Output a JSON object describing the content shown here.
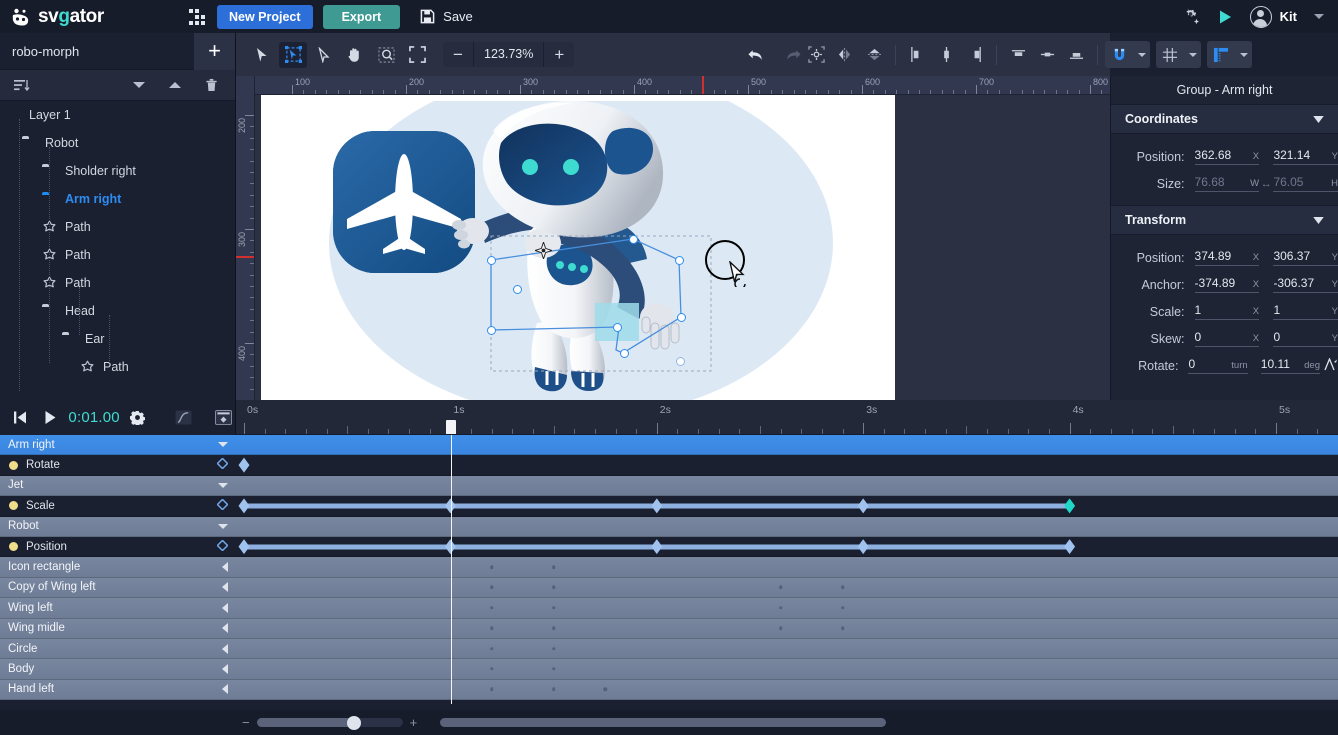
{
  "app": {
    "logo_text_sv": "sv",
    "logo_text_g": "g",
    "logo_text_ator": "ator",
    "accent_blue": "#2c6fd8",
    "accent_teal": "#3e9a93",
    "accent_cyan": "#3ddbd0",
    "selection_blue": "#2e8bf0"
  },
  "topbar": {
    "grid_icon": "apps-grid-icon",
    "new_project_label": "New Project",
    "export_label": "Export",
    "save_label": "Save",
    "save_icon": "floppy-disk-icon",
    "settings_icon": "gear-sparkle-icon",
    "preview_icon": "play-icon",
    "avatar_icon": "user-avatar-icon",
    "user_name": "Kit",
    "account_caret": "chevron-down-icon"
  },
  "left_panel": {
    "project_name": "robo-morph",
    "add_button_label": "+",
    "sort_icon": "sort-list-icon",
    "move_down_icon": "chevron-down-icon",
    "move_up_icon": "chevron-up-icon",
    "delete_icon": "trash-icon",
    "tree": [
      {
        "label": "Layer 1",
        "icon": "page-icon",
        "depth": 0,
        "selected": false
      },
      {
        "label": "Robot",
        "icon": "folder-icon",
        "depth": 1,
        "selected": false
      },
      {
        "label": "Sholder right",
        "icon": "folder-icon",
        "depth": 2,
        "selected": false
      },
      {
        "label": "Arm right",
        "icon": "folder-icon",
        "depth": 2,
        "selected": true
      },
      {
        "label": "Path",
        "icon": "path-icon",
        "depth": 2,
        "selected": false
      },
      {
        "label": "Path",
        "icon": "path-icon",
        "depth": 2,
        "selected": false
      },
      {
        "label": "Path",
        "icon": "path-icon",
        "depth": 2,
        "selected": false
      },
      {
        "label": "Head",
        "icon": "folder-icon",
        "depth": 2,
        "selected": false
      },
      {
        "label": "Ear",
        "icon": "folder-icon",
        "depth": 3,
        "selected": false
      },
      {
        "label": "Path",
        "icon": "path-icon",
        "depth": 4,
        "selected": false
      }
    ]
  },
  "toolbar": {
    "tools": [
      {
        "name": "select-tool",
        "glyph": "arrow",
        "active": false
      },
      {
        "name": "transform-tool",
        "glyph": "transform",
        "active": true
      },
      {
        "name": "direct-select-tool",
        "glyph": "arrow-hollow",
        "active": false
      },
      {
        "name": "hand-tool",
        "glyph": "hand",
        "active": false
      },
      {
        "name": "zoom-region-tool",
        "glyph": "magnify-rect",
        "active": false
      },
      {
        "name": "fit-screen-tool",
        "glyph": "fit-frame",
        "active": false
      }
    ],
    "zoom_minus": "−",
    "zoom_value": "123.73%",
    "zoom_plus": "+",
    "undo_icon": "undo-arrow-icon",
    "redo_icon": "redo-arrow-icon",
    "align_tools": [
      {
        "name": "anchor-center-icon"
      },
      {
        "name": "flip-horizontal-icon"
      },
      {
        "name": "flip-vertical-icon"
      },
      {
        "name": "align-left-icon"
      },
      {
        "name": "align-center-h-icon"
      },
      {
        "name": "align-right-icon"
      },
      {
        "name": "align-top-icon"
      },
      {
        "name": "align-middle-v-icon"
      },
      {
        "name": "align-bottom-icon"
      }
    ],
    "magnet_icon": "magnet-snap-icon",
    "grid_icon": "grid-icon",
    "ruler_icon": "rulers-guides-icon",
    "dropdown_caret": "chevron-down-icon"
  },
  "canvas": {
    "ruler_h_labels": [
      "100",
      "200",
      "300",
      "400",
      "500",
      "600",
      "700",
      "800"
    ],
    "ruler_v_labels": [
      "200",
      "300",
      "400"
    ],
    "artboard_bg": "#ffffff",
    "blob_color": "#dce9f5",
    "icon_tile_color": "#1d5690",
    "airplane_icon": "airplane-icon",
    "robot_name": "robot-illustration",
    "selection_name": "arm-right-selection",
    "anchor_point": "anchor-point-icon",
    "cursor_name": "rotate-cursor"
  },
  "right_panel": {
    "title": "Group - Arm right",
    "sections": [
      {
        "name": "coordinates",
        "title": "Coordinates",
        "rows": [
          {
            "label": "Position:",
            "x": "362.68",
            "xu": "X",
            "y": "321.14",
            "yu": "Y",
            "muted": false,
            "link": false
          },
          {
            "label": "Size:",
            "x": "76.68",
            "xu": "W",
            "y": "76.05",
            "yu": "H",
            "muted": true,
            "link": true
          }
        ]
      },
      {
        "name": "transform",
        "title": "Transform",
        "rows": [
          {
            "label": "Position:",
            "x": "374.89",
            "xu": "X",
            "y": "306.37",
            "yu": "Y",
            "muted": false,
            "link": false
          },
          {
            "label": "Anchor:",
            "x": "-374.89",
            "xu": "X",
            "y": "-306.37",
            "yu": "Y",
            "muted": false,
            "link": false
          },
          {
            "label": "Scale:",
            "x": "1",
            "xu": "X",
            "y": "1",
            "yu": "Y",
            "muted": false,
            "link": false
          },
          {
            "label": "Skew:",
            "x": "0",
            "xu": "X",
            "y": "0",
            "yu": "Y",
            "muted": false,
            "link": false
          },
          {
            "label": "Rotate:",
            "x": "0",
            "xu": "turn",
            "y": "10.11",
            "yu": "deg",
            "muted": false,
            "link": false
          }
        ]
      }
    ],
    "collapse_caret": "chevron-down-icon",
    "rotate_mode_icon": "rotate-direction-icon"
  },
  "timeline": {
    "controls": {
      "go_start_icon": "skip-to-start-icon",
      "play_icon": "play-icon",
      "current_time": "0:01.00",
      "settings_icon": "gear-icon",
      "easing_icon": "easing-curve-icon",
      "keyframe_panel_icon": "keyframe-editor-icon"
    },
    "ruler_labels": [
      "0s",
      "1s",
      "2s",
      "3s",
      "4s",
      "5s"
    ],
    "playhead_time": "1s",
    "rows": [
      {
        "label": "Arm right",
        "type": "group",
        "selected": true,
        "caret": "down"
      },
      {
        "label": "Rotate",
        "type": "prop",
        "bulb": true,
        "keyframes": [
          0.0
        ]
      },
      {
        "label": "Jet",
        "type": "group",
        "selected": false,
        "caret": "down"
      },
      {
        "label": "Scale",
        "type": "prop",
        "bulb": true,
        "keyframes": [
          0.0,
          1.0,
          2.0,
          3.0,
          4.0
        ],
        "last_cyan": true
      },
      {
        "label": "Robot",
        "type": "group",
        "selected": false,
        "caret": "down"
      },
      {
        "label": "Position",
        "type": "prop",
        "bulb": true,
        "keyframes": [
          0.0,
          1.0,
          2.0,
          3.0,
          4.0
        ]
      },
      {
        "label": "Icon rectangle",
        "type": "collapsed",
        "dots": [
          1.2,
          1.5
        ]
      },
      {
        "label": "Copy of Wing left",
        "type": "collapsed",
        "dots": [
          1.2,
          1.5,
          2.6,
          2.9
        ]
      },
      {
        "label": "Wing left",
        "type": "collapsed",
        "dots": [
          1.2,
          1.5,
          2.6,
          2.9
        ]
      },
      {
        "label": "Wing midle",
        "type": "collapsed",
        "dots": [
          1.2,
          1.5,
          2.6,
          2.9
        ]
      },
      {
        "label": "Circle",
        "type": "collapsed",
        "dots": [
          1.2,
          1.5
        ]
      },
      {
        "label": "Body",
        "type": "collapsed",
        "dots": [
          1.2,
          1.5
        ]
      },
      {
        "label": "Hand left",
        "type": "collapsed",
        "dots": [
          1.2,
          1.5,
          1.75
        ]
      }
    ],
    "zoom_minus": "−",
    "zoom_plus": "+",
    "zoom_slider_name": "timeline-zoom-slider",
    "hscroll_name": "timeline-horizontal-scrollbar"
  }
}
